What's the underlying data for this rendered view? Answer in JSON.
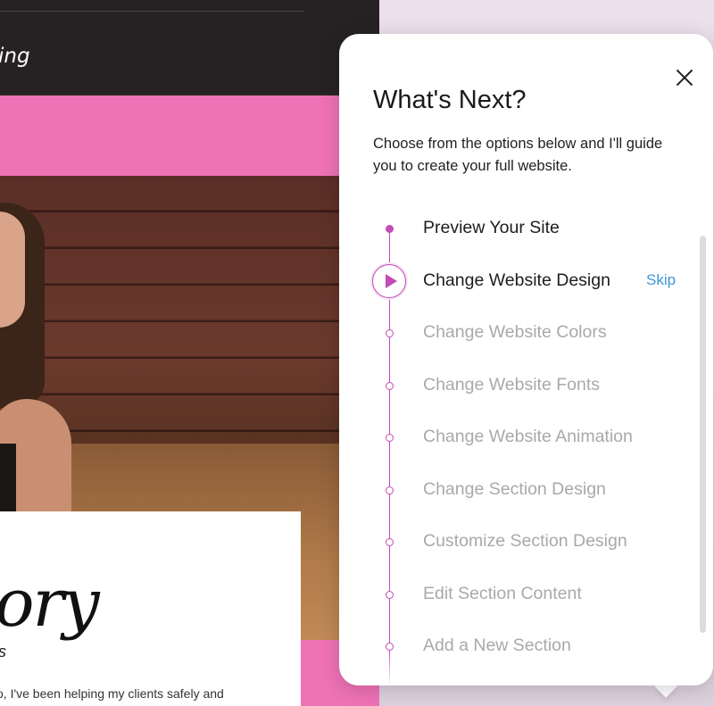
{
  "site": {
    "brand_text": "ing",
    "card_heading": "ory",
    "card_subheading": "s",
    "card_paragraph": "o, I've been helping my clients safely and"
  },
  "dialog": {
    "title": "What's Next?",
    "subtitle": "Choose from the options below and I'll guide you to create your full website.",
    "close_icon": "close-icon",
    "steps": [
      {
        "label": "Preview Your Site",
        "state": "done"
      },
      {
        "label": "Change Website Design",
        "state": "active",
        "action": "Skip"
      },
      {
        "label": "Change Website Colors",
        "state": "pending"
      },
      {
        "label": "Change Website Fonts",
        "state": "pending"
      },
      {
        "label": "Change Website Animation",
        "state": "pending"
      },
      {
        "label": "Change Section Design",
        "state": "pending"
      },
      {
        "label": "Customize Section Design",
        "state": "pending"
      },
      {
        "label": "Edit Section Content",
        "state": "pending"
      },
      {
        "label": "Add a New Section",
        "state": "pending"
      }
    ]
  },
  "colors": {
    "accent": "#c24bb4",
    "link": "#3e97d7",
    "site_pink": "#ee72b6"
  }
}
